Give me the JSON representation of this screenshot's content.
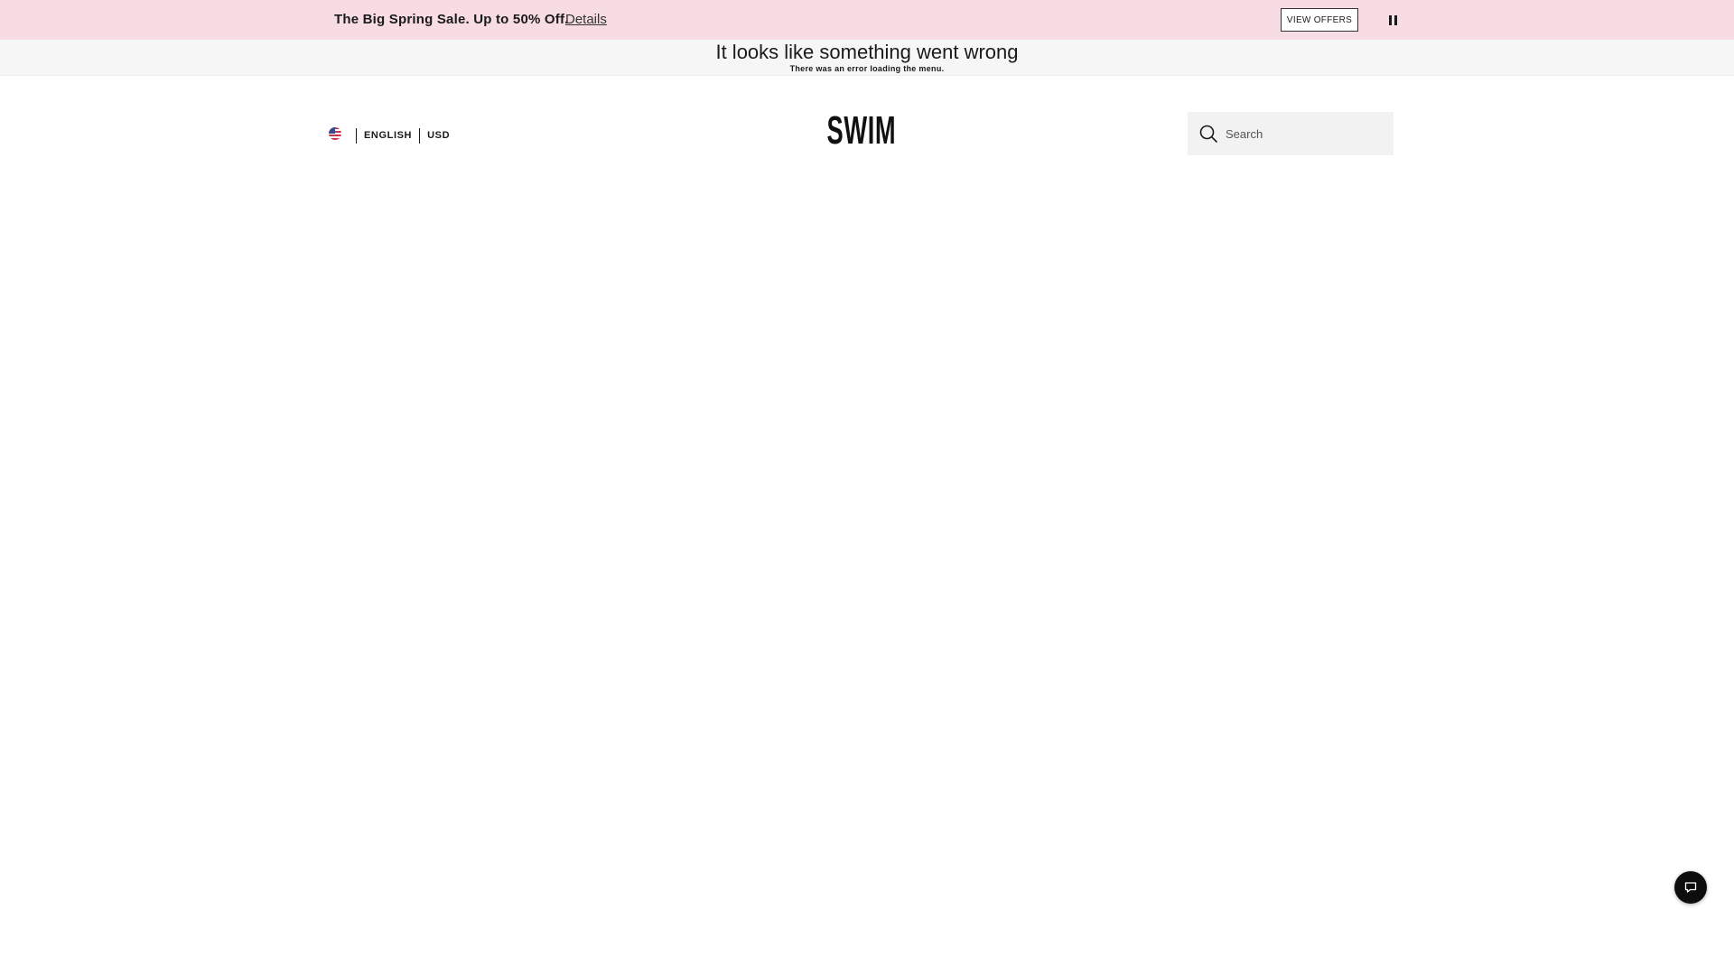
{
  "promo": {
    "text": "The Big Spring Sale. Up to 50% Off.",
    "details_link": "Details",
    "view_offers_label": "VIEW OFFERS",
    "pause_icon": "pause-icon",
    "background": "#f7dde3"
  },
  "error_banner": {
    "title": "It looks like something went wrong",
    "subtitle": "There was an error loading the menu."
  },
  "header": {
    "locale": {
      "flag_icon": "us-flag-icon",
      "language": "ENGLISH",
      "currency": "USD"
    },
    "logo": "SWIM",
    "search": {
      "placeholder": "Search",
      "value": "",
      "icon": "search-icon"
    }
  },
  "chat": {
    "icon": "chat-bubble-icon",
    "background": "#0d0d0d"
  }
}
